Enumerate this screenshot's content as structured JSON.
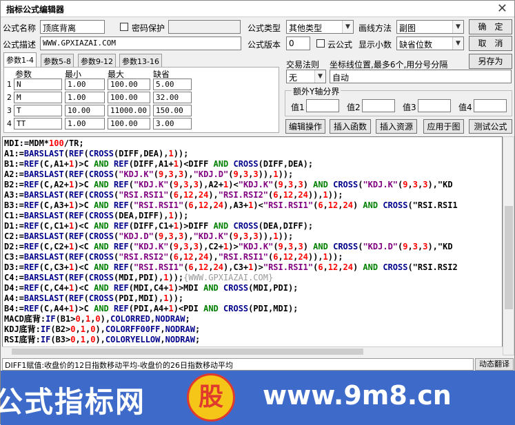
{
  "window": {
    "title": "指标公式编辑器",
    "close_glyph": "✕"
  },
  "form": {
    "name_label": "公式名称",
    "name_value": "顶底背离",
    "password_label": "密码保护",
    "desc_label": "公式描述",
    "desc_value": "WWW.GPXIAZAI.COM",
    "type_label": "公式类型",
    "type_value": "其他类型",
    "draw_label": "画线方法",
    "draw_value": "副图",
    "version_label": "公式版本",
    "version_value": "0",
    "cloud_label": "云公式",
    "decimals_label": "显示小数",
    "decimals_value": "缺省位数"
  },
  "buttons": {
    "ok": "确　定",
    "cancel": "取　消",
    "save_as": "另存为",
    "edit_op": "编辑操作",
    "insert_func": "插入函数",
    "insert_res": "插入资源",
    "apply_chart": "应用于图",
    "test": "测试公式",
    "translate": "动态翻译"
  },
  "tabs": [
    "参数1-4",
    "参数5-8",
    "参数9-12",
    "参数13-16"
  ],
  "params": {
    "headers": [
      "参数",
      "最小",
      "最大",
      "缺省"
    ],
    "rows": [
      {
        "num": "1",
        "name": "N",
        "min": "1.00",
        "max": "100.00",
        "def": "5.00"
      },
      {
        "num": "2",
        "name": "M",
        "min": "1.00",
        "max": "100.00",
        "def": "32.00"
      },
      {
        "num": "3",
        "name": "T",
        "min": "10.00",
        "max": "11000.00",
        "def": "150.00"
      },
      {
        "num": "4",
        "name": "TT",
        "min": "1.00",
        "max": "100.00",
        "def": "3.00"
      }
    ]
  },
  "trade": {
    "rule_label": "交易法则",
    "rule_value": "无",
    "coord_label": "坐标线位置,最多6个,用分号分隔",
    "coord_value": "自动"
  },
  "yaxis": {
    "title": "额外Y轴分界",
    "labels": [
      "值1",
      "值2",
      "值3",
      "值4"
    ]
  },
  "code": [
    "MDI:=MDM*100/TR;",
    "A1:=BARSLAST(REF(CROSS(DIFF,DEA),1));",
    "B1:=REF(C,A1+1)>C AND REF(DIFF,A1+1)<DIFF AND CROSS(DIFF,DEA);",
    "A2:=BARSLAST(REF(CROSS(\"KDJ.K\"(9,3,3),\"KDJ.D\"(9,3,3)),1));",
    "B2:=REF(C,A2+1)>C AND REF(\"KDJ.K\"(9,3,3),A2+1)<\"KDJ.K\"(9,3,3) AND CROSS(\"KDJ.K\"(9,3,3),\"KD",
    "A3:=BARSLAST(REF(CROSS(\"RSI.RSI1\"(6,12,24),\"RSI.RSI2\"(6,12,24)),1));",
    "B3:=REF(C,A3+1)>C AND REF(\"RSI.RSI1\"(6,12,24),A3+1)<\"RSI.RSI1\"(6,12,24) AND CROSS(\"RSI.RSI1",
    "C1:=BARSLAST(REF(CROSS(DEA,DIFF),1));",
    "D1:=REF(C,C1+1)<C AND REF(DIFF,C1+1)>DIFF AND CROSS(DEA,DIFF);",
    "C2:=BARSLAST(REF(CROSS(\"KDJ.D\"(9,3,3),\"KDJ.K\"(9,3,3)),1));",
    "D2:=REF(C,C2+1)<C AND REF(\"KDJ.K\"(9,3,3),C2+1)>\"KDJ.K\"(9,3,3) AND CROSS(\"KDJ.D\"(9,3,3),\"KD",
    "C3:=BARSLAST(REF(CROSS(\"RSI.RSI2\"(6,12,24),\"RSI.RSI1\"(6,12,24)),1));",
    "D3:=REF(C,C3+1)<C AND REF(\"RSI.RSI1\"(6,12,24),C3+1)>\"RSI.RSI1\"(6,12,24) AND CROSS(\"RSI.RSI2",
    "C4:=BARSLAST(REF(CROSS(MDI,PDI),1));{WWW.GPXIAZAI.COM}",
    "D4:=REF(C,C4+1)<C AND REF(MDI,C4+1)>MDI AND CROSS(MDI,PDI);",
    "A4:=BARSLAST(REF(CROSS(PDI,MDI),1));",
    "B4:=REF(C,A4+1)>C AND REF(PDI,A4+1)<PDI AND CROSS(PDI,MDI);",
    "MACD底背:IF(B1>0,1,0),COLORRED,NODRAW;",
    "KDJ底背:IF(B2>0,1,0),COLORFF00FF,NODRAW;",
    "RSI底背:IF(B3>0,1,0),COLORYELLOW,NODRAW;"
  ],
  "status": "DIFF1赋值:收盘价的12日指数移动平均-收盘价的26日指数移动平均",
  "banner": {
    "left": "公式指标网",
    "logo": "股",
    "right": "www.9m8.cn"
  }
}
